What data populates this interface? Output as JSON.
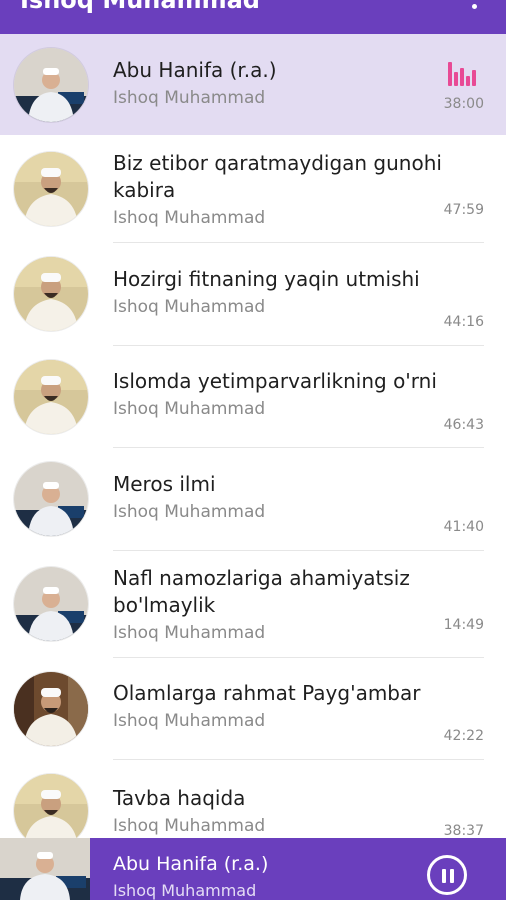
{
  "app_bar": {
    "title": "Ishoq Muhammad",
    "more_icon": "more-vert-icon"
  },
  "colors": {
    "primary": "#6a3fbd",
    "active_row": "#e3dcf2",
    "equalizer": "#e84a95"
  },
  "tracks": [
    {
      "title": "Abu Hanifa (r.a.)",
      "artist": "Ishoq Muhammad",
      "duration": "38:00",
      "playing": true
    },
    {
      "title": "Biz etibor qaratmaydigan gunohi kabira",
      "artist": "Ishoq Muhammad",
      "duration": "47:59",
      "playing": false
    },
    {
      "title": "Hozirgi fitnaning yaqin utmishi",
      "artist": "Ishoq Muhammad",
      "duration": "44:16",
      "playing": false
    },
    {
      "title": "Islomda yetimparvarlikning o'rni",
      "artist": "Ishoq Muhammad",
      "duration": "46:43",
      "playing": false
    },
    {
      "title": "Meros ilmi",
      "artist": "Ishoq Muhammad",
      "duration": "41:40",
      "playing": false
    },
    {
      "title": "Nafl namozlariga ahamiyatsiz bo'lmaylik",
      "artist": "Ishoq Muhammad",
      "duration": "14:49",
      "playing": false
    },
    {
      "title": "Olamlarga rahmat Payg'ambar",
      "artist": "Ishoq Muhammad",
      "duration": "42:22",
      "playing": false
    },
    {
      "title": "Tavba haqida",
      "artist": "Ishoq Muhammad",
      "duration": "38:37",
      "playing": false
    }
  ],
  "now_playing": {
    "title": "Abu Hanifa (r.a.)",
    "artist": "Ishoq Muhammad",
    "control_icon": "pause-icon"
  }
}
